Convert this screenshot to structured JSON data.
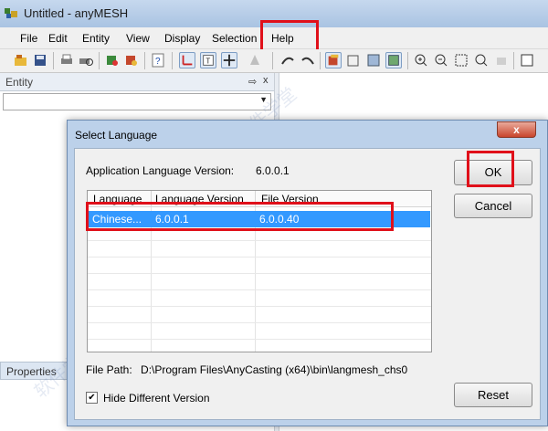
{
  "window": {
    "title": "Untitled - anyMESH",
    "menu": [
      "File",
      "Edit",
      "Entity",
      "View",
      "Display",
      "Selection",
      "Help"
    ]
  },
  "panel": {
    "title": "Entity",
    "pin_glyph": "⇨",
    "close_glyph": "x",
    "properties_tab": "Properties"
  },
  "dialog": {
    "title": "Select Language",
    "close_glyph": "x",
    "app_version_label": "Application Language Version:",
    "app_version_value": "6.0.0.1",
    "columns": [
      "Language",
      "Language Version",
      "File Version"
    ],
    "rows": [
      {
        "language": "Chinese...",
        "language_version": "6.0.0.1",
        "file_version": "6.0.0.40",
        "selected": true
      }
    ],
    "file_path_label": "File Path:",
    "file_path_value": "D:\\Program Files\\AnyCasting (x64)\\bin\\langmesh_chs0",
    "hide_label": "Hide Different Version",
    "hide_checked": true,
    "ok_label": "OK",
    "cancel_label": "Cancel",
    "reset_label": "Reset"
  },
  "colors": {
    "highlight": "#e0101a",
    "selection": "#3399ff",
    "dialog_frame": "#bcd1ea"
  }
}
